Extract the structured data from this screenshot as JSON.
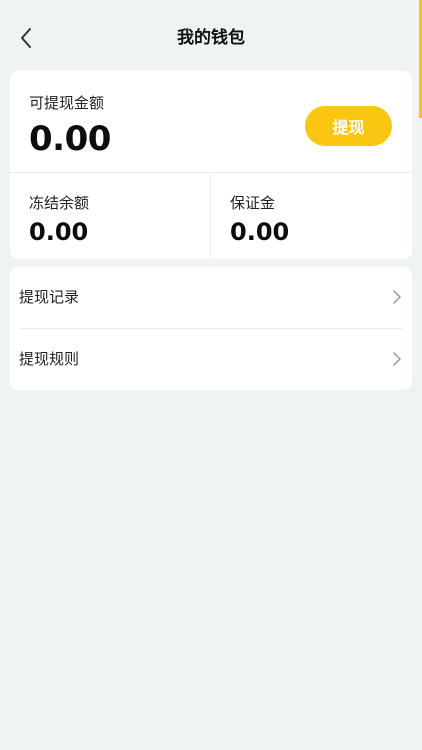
{
  "header": {
    "title": "我的钱包",
    "back_icon": "chevron-left-icon"
  },
  "balance": {
    "withdrawable_label": "可提现金额",
    "withdrawable_amount": "0.00",
    "withdraw_button_label": "提现",
    "frozen_label": "冻结余额",
    "frozen_amount": "0.00",
    "deposit_label": "保证金",
    "deposit_amount": "0.00"
  },
  "menu": {
    "items": [
      {
        "label": "提现记录",
        "icon": "chevron-right-icon"
      },
      {
        "label": "提现规则",
        "icon": "chevron-right-icon"
      }
    ]
  },
  "colors": {
    "accent": "#fbc612",
    "background": "#eff3f3",
    "card": "#ffffff"
  }
}
